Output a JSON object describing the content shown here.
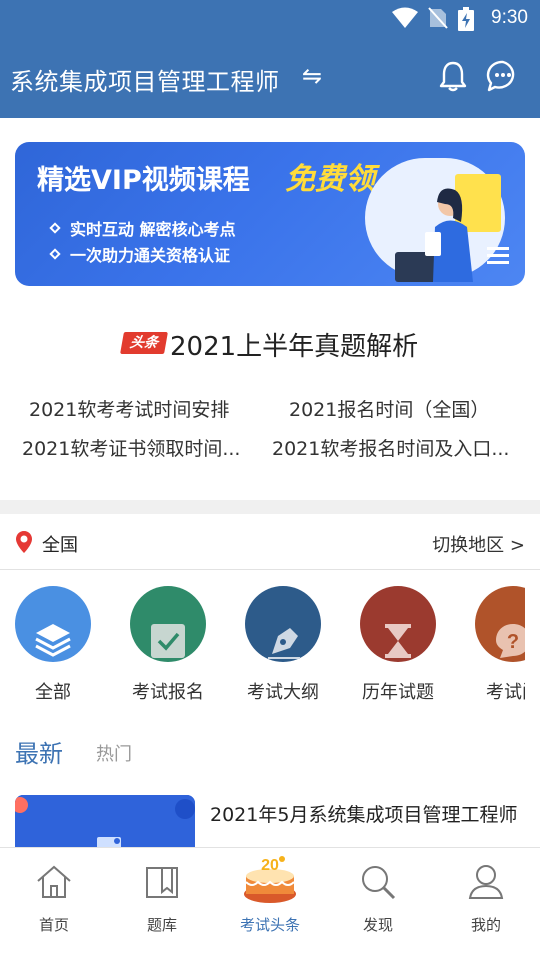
{
  "status_bar": {
    "time": "9:30"
  },
  "header": {
    "title": "系统集成项目管理工程师",
    "swap_glyph": "⇋",
    "icons": [
      "bell-icon",
      "chat-icon"
    ]
  },
  "banner": {
    "title": "精选VIP视频课程",
    "highlight": "免费领",
    "lines": [
      "实时互动 解密核心考点",
      "一次助力通关资格认证"
    ]
  },
  "headline": {
    "badge": "头条",
    "title": "2021上半年真题解析",
    "links": [
      "2021软考考试时间安排",
      "2021报名时间（全国）",
      "2021软考证书领取时间...",
      "2021软考报名时间及入口..."
    ]
  },
  "region": {
    "current": "全国",
    "switch_label": "切换地区 >"
  },
  "categories": [
    {
      "label": "全部",
      "icon": "layers-icon",
      "color": "#4a90e2"
    },
    {
      "label": "考试报名",
      "icon": "checkbox-icon",
      "color": "#2f8b6a"
    },
    {
      "label": "考试大纲",
      "icon": "pen-nib-icon",
      "color": "#2d5b8a"
    },
    {
      "label": "历年试题",
      "icon": "hourglass-icon",
      "color": "#9b3a2f"
    },
    {
      "label": "考试问",
      "icon": "question-icon",
      "color": "#b0532a"
    }
  ],
  "feed_tabs": {
    "active": "最新",
    "inactive": "热门"
  },
  "articles": [
    {
      "title": "2021年5月系统集成项目管理工程师"
    }
  ],
  "bottom_nav": [
    {
      "label": "首页",
      "icon": "home-icon"
    },
    {
      "label": "题库",
      "icon": "question-bank-icon"
    },
    {
      "label": "考试头条",
      "icon": "cake-icon",
      "active": true
    },
    {
      "label": "发现",
      "icon": "search-icon"
    },
    {
      "label": "我的",
      "icon": "user-icon"
    }
  ],
  "colors": {
    "primary": "#3d73b3",
    "badge_red": "#e23b2e",
    "banner_yellow": "#ffdc3a"
  }
}
